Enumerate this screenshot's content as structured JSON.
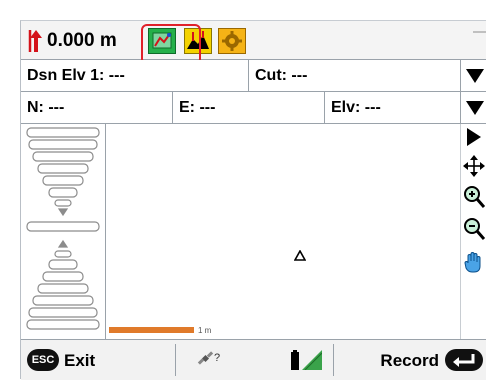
{
  "toolbar": {
    "height_value": "0.000 m",
    "icons": [
      "height-arrow-icon",
      "map-view-icon",
      "cut-fill-profile-icon",
      "settings-gear-icon"
    ],
    "highlight_color": "#e0202a"
  },
  "info_row1": {
    "dsn_elv_label": "Dsn Elv 1: ---",
    "cut_label": "Cut: ---"
  },
  "info_row2": {
    "n_label": "N: ---",
    "e_label": "E: ---",
    "elv_label": "Elv: ---"
  },
  "plot": {
    "scale_label": "1 m",
    "scale_color": "#e07a2a"
  },
  "tool_rail": [
    "expand-right-icon",
    "pan-arrows-icon",
    "zoom-in-icon",
    "zoom-out-icon",
    "hand-pan-icon"
  ],
  "bottombar": {
    "esc_label": "ESC",
    "exit_label": "Exit",
    "gps_status": "?",
    "record_label": "Record"
  }
}
